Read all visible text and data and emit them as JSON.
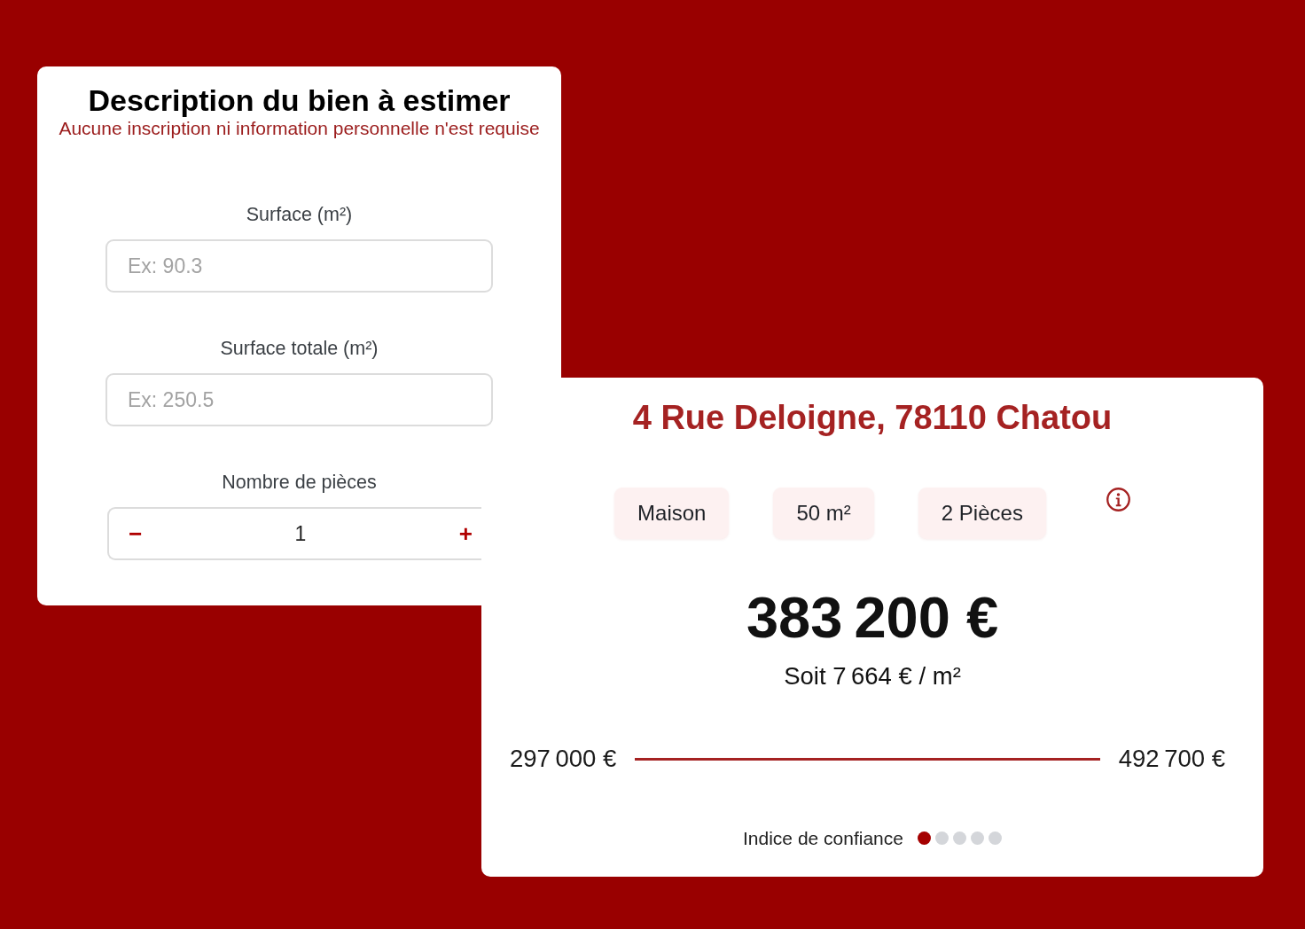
{
  "form_card": {
    "title": "Description du bien à estimer",
    "subtitle": "Aucune inscription ni information personnelle n'est requise",
    "fields": [
      {
        "kind": "input",
        "label": "Surface (m²)",
        "placeholder": "Ex: 90.3"
      },
      {
        "kind": "input",
        "label": "Surface totale (m²)",
        "placeholder": "Ex: 250.5"
      },
      {
        "kind": "stepper",
        "label": "Nombre de pièces",
        "value": "1",
        "decrement": "−",
        "increment": "+"
      }
    ]
  },
  "result_card": {
    "address": "4 Rue Deloigne, 78110 Chatou",
    "chips": [
      "Maison",
      "50 m²",
      "2 Pièces"
    ],
    "price": "383 200 €",
    "price_per_m2": "Soit 7 664 € / m²",
    "range": {
      "low": "297 000 €",
      "high": "492 700 €"
    },
    "confidence": {
      "label": "Indice de confiance",
      "stars": 1
    }
  }
}
